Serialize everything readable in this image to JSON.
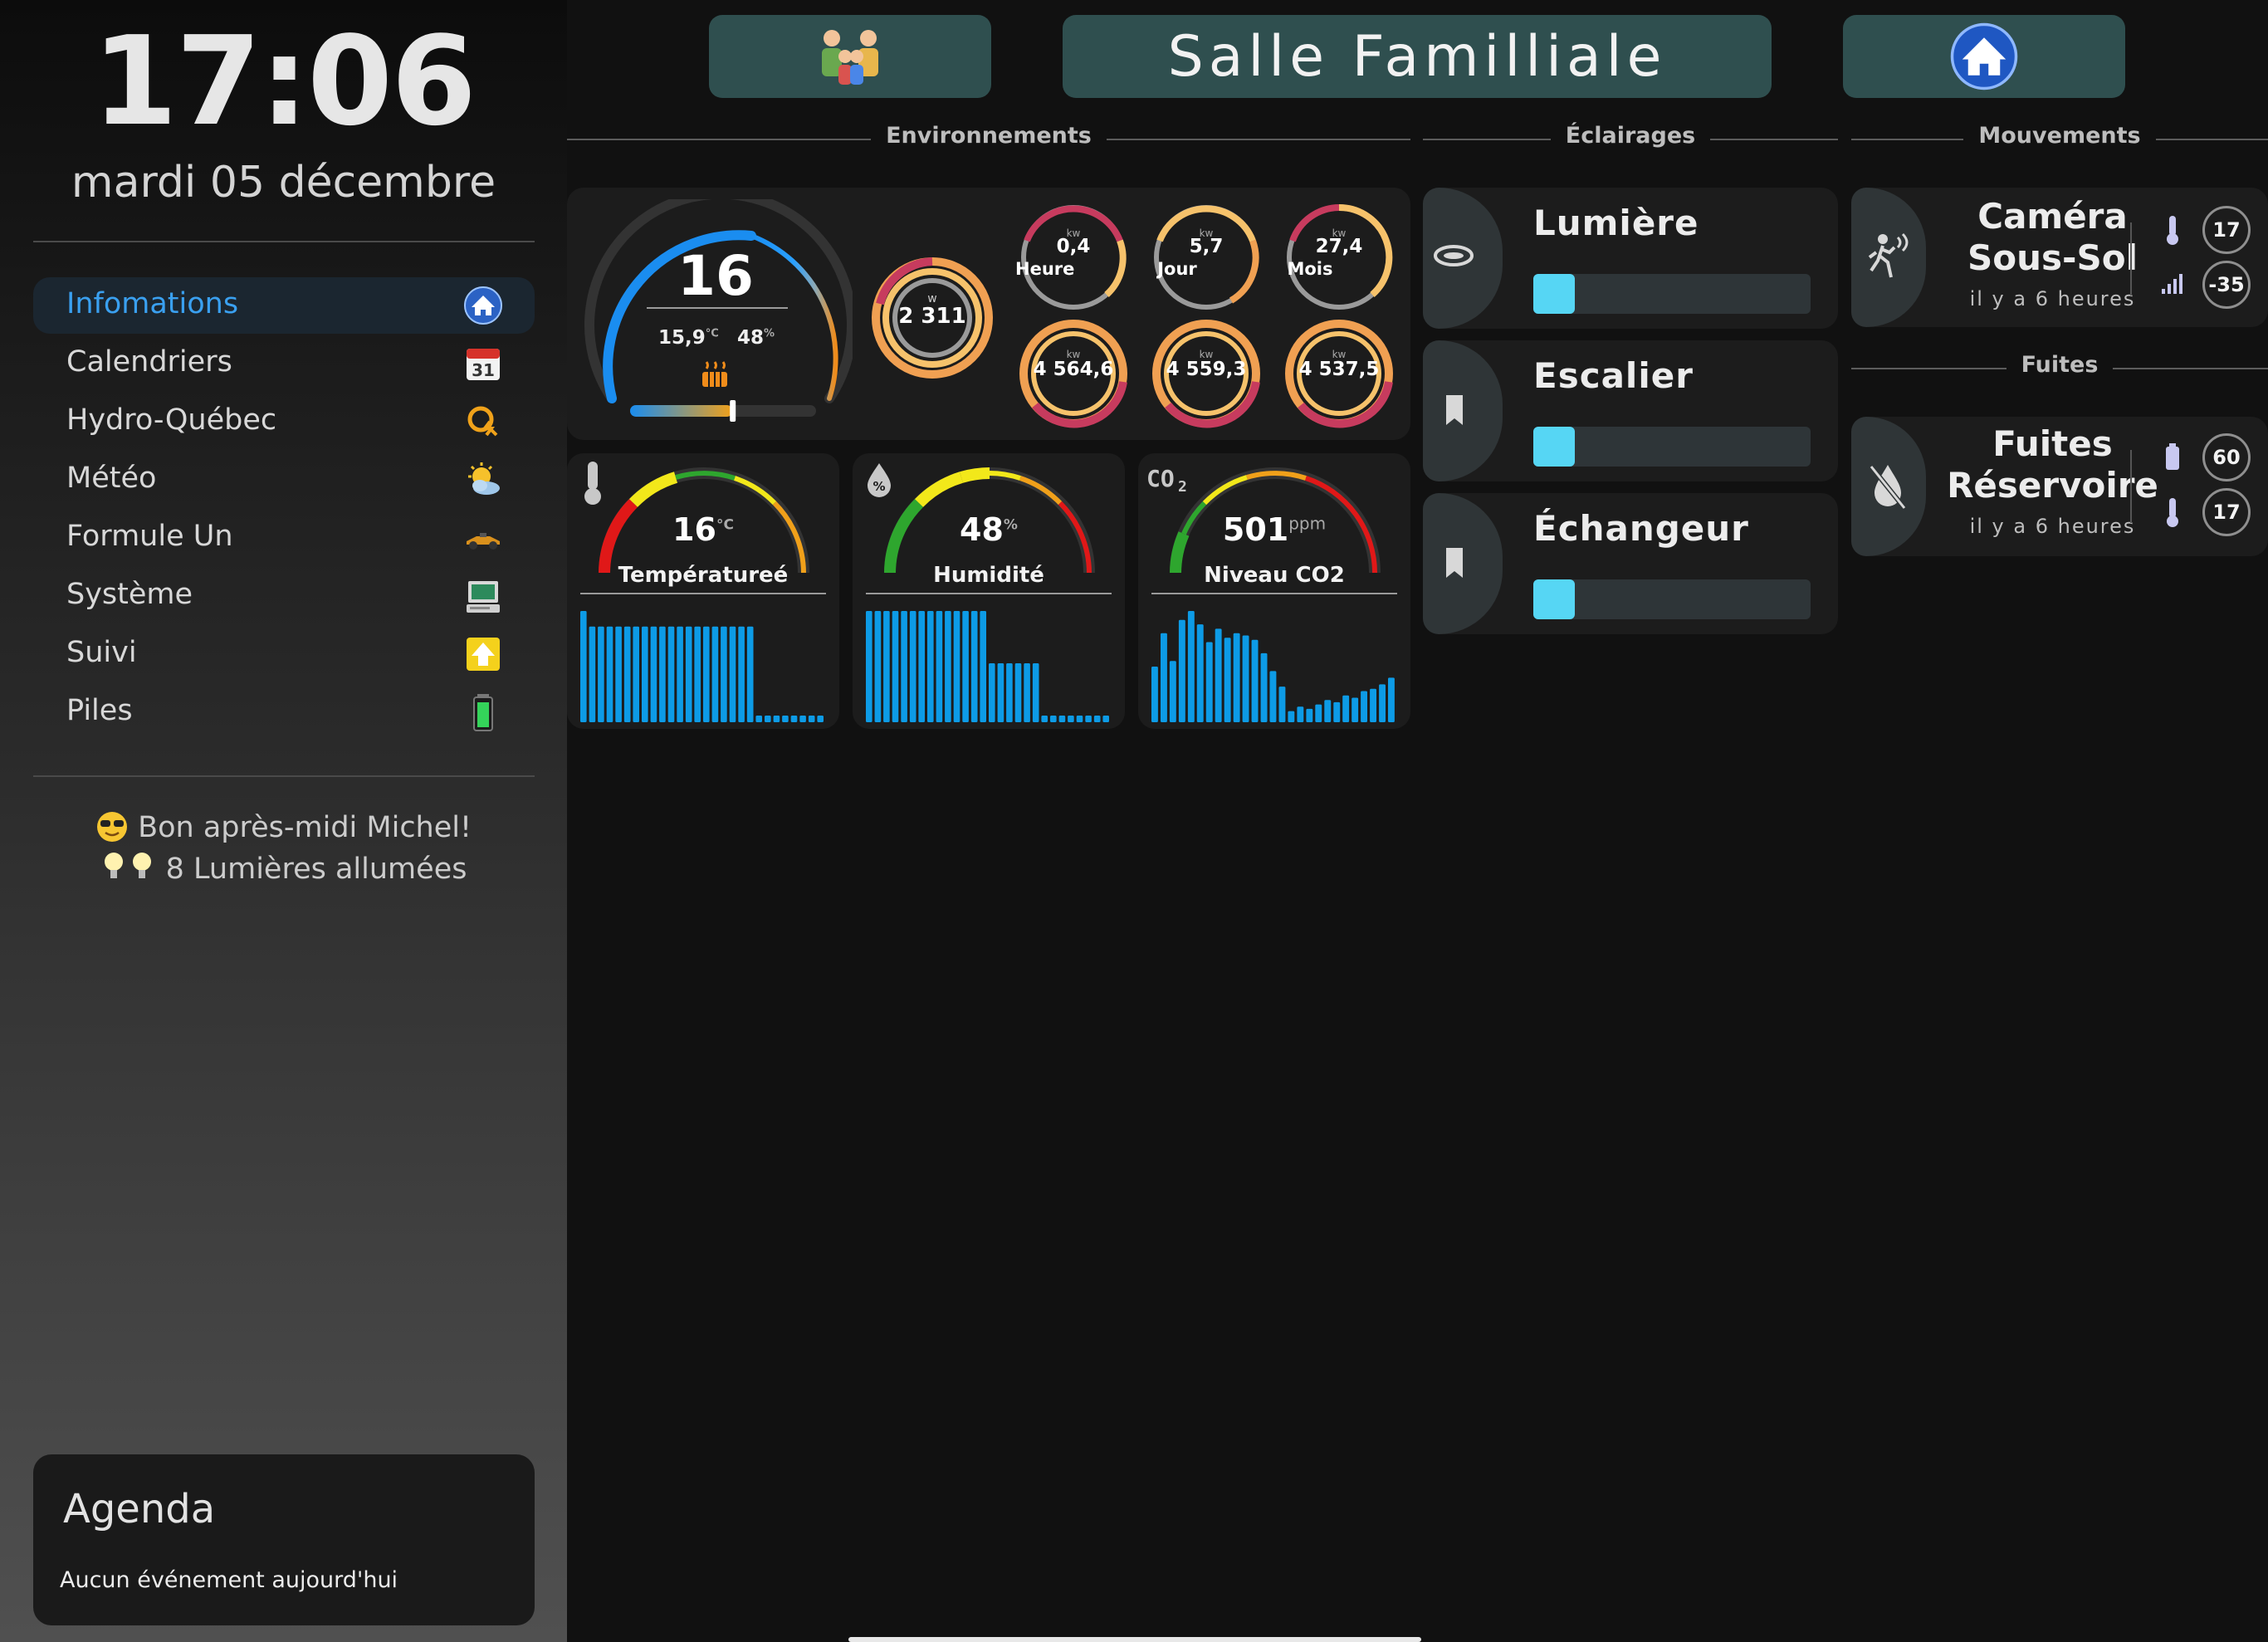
{
  "sidebar": {
    "time": "17:06",
    "date": "mardi 05 décembre",
    "menu": [
      {
        "label": "Infomations",
        "icon": "home-icon",
        "active": true
      },
      {
        "label": "Calendriers",
        "icon": "calendar-icon",
        "active": false
      },
      {
        "label": "Hydro-Québec",
        "icon": "hydro-quebec-icon",
        "active": false
      },
      {
        "label": "Météo",
        "icon": "weather-icon",
        "active": false
      },
      {
        "label": "Formule Un",
        "icon": "race-car-icon",
        "active": false
      },
      {
        "label": "Système",
        "icon": "computer-icon",
        "active": false
      },
      {
        "label": "Suivi",
        "icon": "arrow-up-icon",
        "active": false
      },
      {
        "label": "Piles",
        "icon": "battery-icon",
        "active": false
      }
    ],
    "greeting": "Bon après-midi Michel!",
    "lights_on": "8 Lumières allumées",
    "agenda": {
      "title": "Agenda",
      "empty": "Aucun événement aujourd'hui"
    }
  },
  "header": {
    "title": "Salle Familliale",
    "left_icon": "family-icon",
    "right_icon": "home-icon"
  },
  "sections": {
    "environment": "Environnements",
    "lighting": "Éclairages",
    "motion": "Mouvements",
    "leaks": "Fuites"
  },
  "thermostat": {
    "setpoint": "16",
    "current_temp": "15,9",
    "temp_unit": "°C",
    "humidity": "48",
    "humidity_unit": "%",
    "heating_icon": "heating-icon",
    "slider_level": 0.55
  },
  "power": {
    "current": {
      "unit": "w",
      "value": "2 311"
    },
    "periods": [
      {
        "label": "Heure",
        "unit": "kw",
        "value": "0,4",
        "total_unit": "kw",
        "total": "4 564,6"
      },
      {
        "label": "Jour",
        "unit": "kw",
        "value": "5,7",
        "total_unit": "kw",
        "total": "4 559,3"
      },
      {
        "label": "Mois",
        "unit": "kw",
        "value": "27,4",
        "total_unit": "kw",
        "total": "4 537,5"
      }
    ]
  },
  "sensors": [
    {
      "name": "Températureé",
      "value": "16",
      "unit": "°C",
      "icon": "thermometer-icon",
      "level": 0.45,
      "history": [
        1,
        0.86,
        0.86,
        0.86,
        0.86,
        0.86,
        0.86,
        0.86,
        0.86,
        0.86,
        0.86,
        0.86,
        0.86,
        0.86,
        0.86,
        0.86,
        0.86,
        0.86,
        0.86,
        0.86,
        0.06,
        0.06,
        0.06,
        0.06,
        0.06,
        0.06,
        0.06,
        0.06
      ]
    },
    {
      "name": "Humidité",
      "value": "48",
      "unit": "%",
      "icon": "humidity-icon",
      "level": 0.48,
      "history": [
        1,
        1,
        1,
        1,
        1,
        1,
        1,
        1,
        1,
        1,
        1,
        1,
        1,
        1,
        0.53,
        0.53,
        0.53,
        0.53,
        0.53,
        0.53,
        0.06,
        0.06,
        0.06,
        0.06,
        0.06,
        0.06,
        0.06,
        0.06
      ]
    },
    {
      "name": "Niveau CO2",
      "value": "501",
      "unit": "ppm",
      "icon": "co2-icon",
      "level": 0.3,
      "history": [
        0.5,
        0.8,
        0.55,
        0.92,
        1,
        0.88,
        0.72,
        0.84,
        0.76,
        0.8,
        0.78,
        0.74,
        0.62,
        0.46,
        0.32,
        0.1,
        0.14,
        0.12,
        0.16,
        0.2,
        0.18,
        0.24,
        0.22,
        0.28,
        0.3,
        0.34,
        0.4
      ]
    }
  ],
  "lights": [
    {
      "name": "Lumière",
      "icon": "ceiling-light-icon",
      "level": 0.15
    },
    {
      "name": "Escalier",
      "icon": "bookmark-icon",
      "level": 0.15
    },
    {
      "name": "Échangeur",
      "icon": "bookmark-icon",
      "level": 0.15
    }
  ],
  "motion": {
    "name_line1": "Caméra",
    "name_line2": "Sous-Sol",
    "ago": "il y a 6 heures",
    "temp": "17",
    "signal": "-35",
    "icon": "motion-sensor-icon"
  },
  "leak": {
    "name_line1": "Fuites",
    "name_line2": "Réservoire",
    "ago": "il y a 6 heures",
    "battery": "60",
    "temp": "17",
    "icon": "water-off-icon"
  },
  "colors": {
    "accent": "#3aa0f0",
    "header_button": "#2f4f4f",
    "light_fill": "#56d6f4",
    "bar": "#0d9be6"
  }
}
